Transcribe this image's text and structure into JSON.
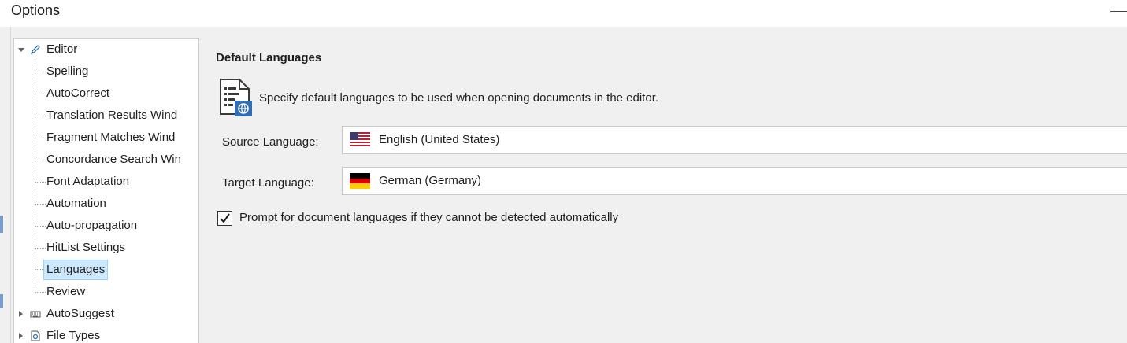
{
  "window": {
    "title": "Options"
  },
  "tree": {
    "items": [
      {
        "label": "Editor",
        "icon": "pencil-icon",
        "expander": "expanded"
      },
      {
        "label": "Spelling"
      },
      {
        "label": "AutoCorrect"
      },
      {
        "label": "Translation Results Wind"
      },
      {
        "label": "Fragment Matches Wind"
      },
      {
        "label": "Concordance Search Win"
      },
      {
        "label": "Font Adaptation"
      },
      {
        "label": "Automation"
      },
      {
        "label": "Auto-propagation"
      },
      {
        "label": "HitList Settings"
      },
      {
        "label": "Languages",
        "selected": true
      },
      {
        "label": "Review"
      },
      {
        "label": "AutoSuggest",
        "icon": "keyboard-icon",
        "expander": "collapsed"
      },
      {
        "label": "File Types",
        "icon": "file-types-icon",
        "expander": "collapsed"
      }
    ]
  },
  "panel": {
    "heading": "Default Languages",
    "description": "Specify default languages to be used when opening documents in the editor.",
    "source": {
      "label": "Source Language:",
      "value": "English (United States)",
      "flag": "us-flag-icon"
    },
    "target": {
      "label": "Target Language:",
      "value": "German (Germany)",
      "flag": "de-flag-icon"
    },
    "prompt_checkbox": {
      "label": "Prompt for document languages if they cannot be detected automatically",
      "checked": true
    }
  },
  "colors": {
    "selection_bg": "#cce8ff",
    "selection_border": "#99d1ff",
    "icon_blue": "#2f6fb5"
  }
}
